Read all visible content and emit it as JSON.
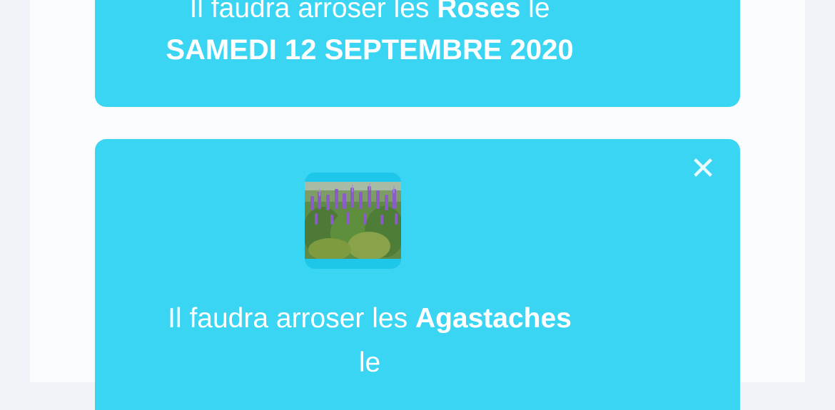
{
  "cards": [
    {
      "prefix": "Il faudra arroser les ",
      "plant": "Roses",
      "suffix": " le",
      "date": "SAMEDI 12 SEPTEMBRE 2020"
    },
    {
      "prefix": "Il faudra arroser les ",
      "plant": "Agastaches",
      "suffix": "le",
      "close_icon": "close-icon",
      "image_alt": "Agastache plant thumbnail"
    }
  ],
  "colors": {
    "page_background": "#f0f3f8",
    "content_background": "#fbfcfe",
    "card_background": "#3ad5f2",
    "text": "#ffffff"
  }
}
